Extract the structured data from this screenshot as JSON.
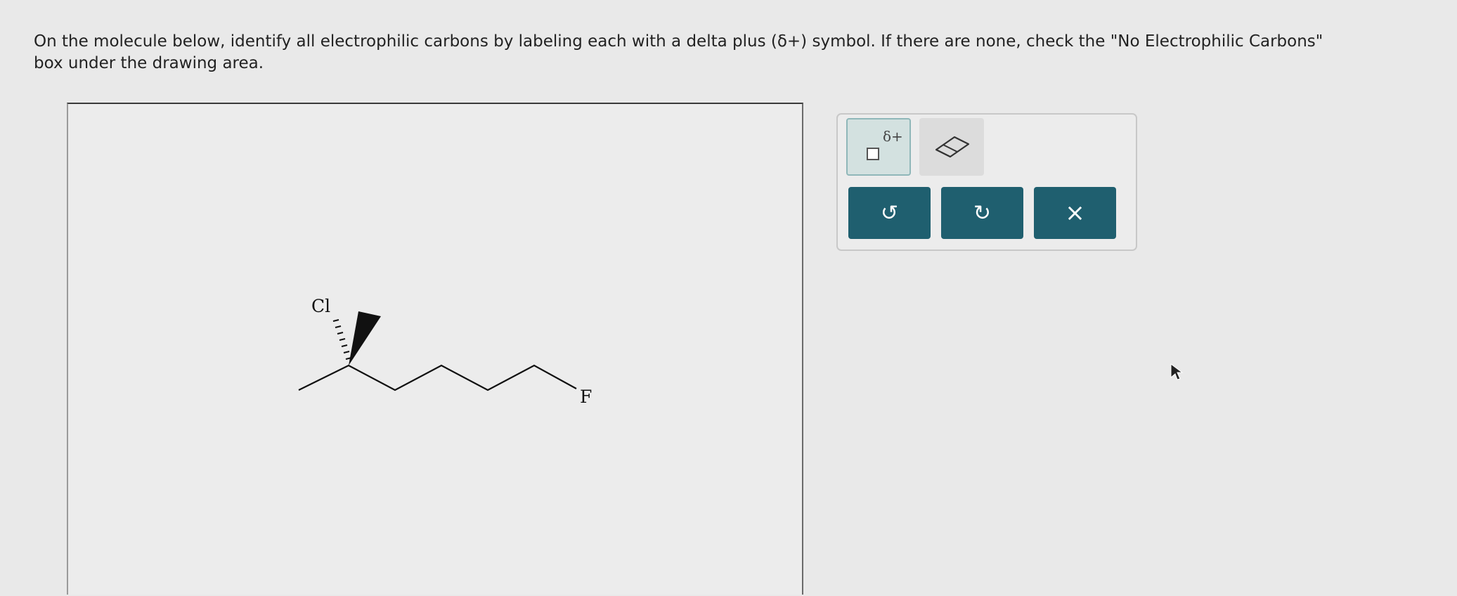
{
  "instructions": {
    "line1": "On the molecule below, identify all electrophilic carbons by labeling each with a delta plus (δ+) symbol. If there are none, check the \"No Electrophilic Carbons\"",
    "line2": "box under the drawing area."
  },
  "molecule": {
    "atom_labels": {
      "chlorine": "Cl",
      "fluorine": "F"
    }
  },
  "toolbar": {
    "delta_tool_symbol": "δ+",
    "undo_icon": "undo-arrow-icon",
    "redo_icon": "redo-arrow-icon",
    "clear_icon": "close-x-icon",
    "undo_glyph": "↺",
    "redo_glyph": "↻",
    "clear_glyph": "×"
  },
  "colors": {
    "button_bg": "#1f5f6f",
    "delta_tool_bg": "#d3e1e0",
    "page_bg": "#e9e9e9"
  }
}
